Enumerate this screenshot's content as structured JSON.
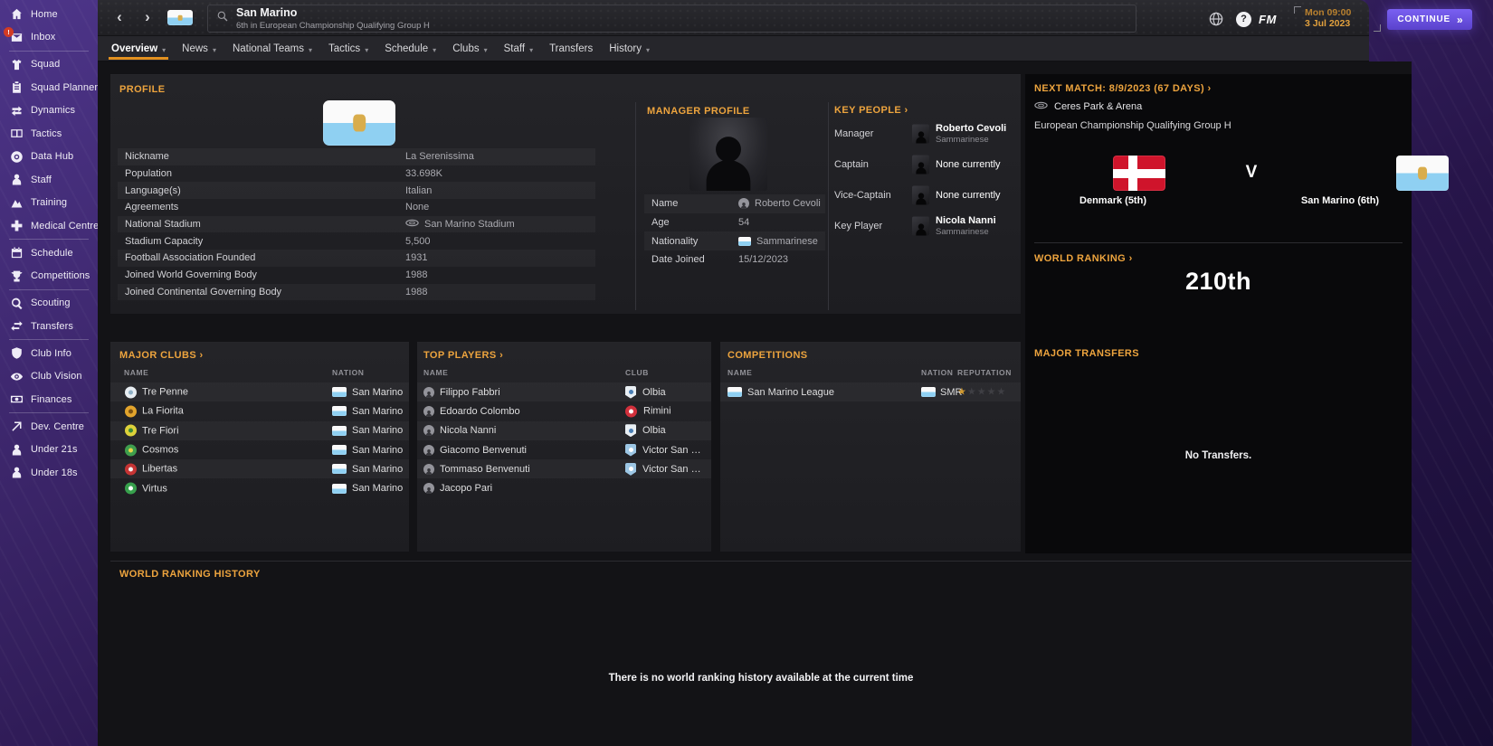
{
  "app": {
    "continue_label": "CONTINUE",
    "continue_arrows": "»",
    "back_glyph": "‹",
    "forward_glyph": "›",
    "help_glyph": "?",
    "fm_logo": "FM",
    "clock": {
      "time_line": "Mon 09:00",
      "date_line": "3 Jul 2023"
    }
  },
  "header": {
    "title": "San Marino",
    "subtitle": "6th in European Championship Qualifying Group H"
  },
  "tabs": [
    {
      "label": "Overview",
      "caret": true,
      "active": true
    },
    {
      "label": "News",
      "caret": true
    },
    {
      "label": "National Teams",
      "caret": true
    },
    {
      "label": "Tactics",
      "caret": true
    },
    {
      "label": "Schedule",
      "caret": true
    },
    {
      "label": "Clubs",
      "caret": true
    },
    {
      "label": "Staff",
      "caret": true
    },
    {
      "label": "Transfers",
      "caret": false
    },
    {
      "label": "History",
      "caret": true
    }
  ],
  "sidebar": [
    {
      "label": "Home",
      "icon": "home-icon"
    },
    {
      "label": "Inbox",
      "icon": "inbox-icon",
      "badge": "!",
      "divider_after": true
    },
    {
      "label": "Squad",
      "icon": "squad-icon"
    },
    {
      "label": "Squad Planner",
      "icon": "squad-planner-icon"
    },
    {
      "label": "Dynamics",
      "icon": "dynamics-icon"
    },
    {
      "label": "Tactics",
      "icon": "tactics-icon"
    },
    {
      "label": "Data Hub",
      "icon": "data-hub-icon"
    },
    {
      "label": "Staff",
      "icon": "staff-icon"
    },
    {
      "label": "Training",
      "icon": "training-icon"
    },
    {
      "label": "Medical Centre",
      "icon": "medical-centre-icon",
      "divider_after": true
    },
    {
      "label": "Schedule",
      "icon": "schedule-icon"
    },
    {
      "label": "Competitions",
      "icon": "competitions-icon",
      "divider_after": true
    },
    {
      "label": "Scouting",
      "icon": "scouting-icon"
    },
    {
      "label": "Transfers",
      "icon": "transfers-icon",
      "divider_after": true
    },
    {
      "label": "Club Info",
      "icon": "club-info-icon"
    },
    {
      "label": "Club Vision",
      "icon": "club-vision-icon"
    },
    {
      "label": "Finances",
      "icon": "finances-icon",
      "divider_after": true
    },
    {
      "label": "Dev. Centre",
      "icon": "dev-centre-icon"
    },
    {
      "label": "Under 21s",
      "icon": "under-21s-icon"
    },
    {
      "label": "Under 18s",
      "icon": "under-18s-icon"
    }
  ],
  "profile": {
    "title": "PROFILE",
    "rows": [
      {
        "label": "Nickname",
        "value": "La Serenissima"
      },
      {
        "label": "Population",
        "value": "33.698K"
      },
      {
        "label": "Language(s)",
        "value": "Italian"
      },
      {
        "label": "Agreements",
        "value": "None"
      },
      {
        "label": "National Stadium",
        "value": "San Marino Stadium",
        "icon": "stadium-icon"
      },
      {
        "label": "Stadium Capacity",
        "value": "5,500"
      },
      {
        "label": "Football Association Founded",
        "value": "1931"
      },
      {
        "label": "Joined World Governing Body",
        "value": "1988"
      },
      {
        "label": "Joined Continental Governing Body",
        "value": "1988"
      }
    ]
  },
  "manager": {
    "title": "MANAGER PROFILE",
    "rows": [
      {
        "label": "Name",
        "value": "Roberto Cevoli",
        "icon": "face-icon"
      },
      {
        "label": "Age",
        "value": "54"
      },
      {
        "label": "Nationality",
        "value": "Sammarinese",
        "icon": "flag-san-marino"
      },
      {
        "label": "Date Joined",
        "value": "15/12/2023"
      }
    ]
  },
  "key_people": {
    "title": "KEY PEOPLE ›",
    "rows": [
      {
        "role": "Manager",
        "name": "Roberto Cevoli",
        "nationality": "Sammarinese"
      },
      {
        "role": "Captain",
        "name": "None currently"
      },
      {
        "role": "Vice-Captain",
        "name": "None currently"
      },
      {
        "role": "Key Player",
        "name": "Nicola Nanni",
        "nationality": "Sammarinese"
      }
    ]
  },
  "next_match": {
    "title": "NEXT MATCH: 8/9/2023 (67 DAYS) ›",
    "venue": "Ceres Park & Arena",
    "competition": "European Championship Qualifying Group H",
    "home_team": "Denmark (5th)",
    "versus": "V",
    "away_team": "San Marino (6th)"
  },
  "world_ranking": {
    "title": "WORLD RANKING ›",
    "value": "210th"
  },
  "major_clubs": {
    "title": "MAJOR CLUBS ›",
    "columns": [
      "NAME",
      "NATION"
    ],
    "rows": [
      {
        "name": "Tre Penne",
        "nation": "San Marino",
        "badge": {
          "shape": "circle",
          "bg": "#e8edf2",
          "accent": "#8fb0c6"
        }
      },
      {
        "name": "La Fiorita",
        "nation": "San Marino",
        "badge": {
          "shape": "circle",
          "bg": "#e2a42c",
          "accent": "#7c5212"
        }
      },
      {
        "name": "Tre Fiori",
        "nation": "San Marino",
        "badge": {
          "shape": "circle",
          "bg": "#ddd23a",
          "accent": "#3a8a3a"
        }
      },
      {
        "name": "Cosmos",
        "nation": "San Marino",
        "badge": {
          "shape": "circle",
          "bg": "#3f9e4d",
          "accent": "#e6d44a"
        }
      },
      {
        "name": "Libertas",
        "nation": "San Marino",
        "badge": {
          "shape": "circle",
          "bg": "#c53434",
          "accent": "#f0f0f0"
        }
      },
      {
        "name": "Virtus",
        "nation": "San Marino",
        "badge": {
          "shape": "circle",
          "bg": "#37a04c",
          "accent": "#ffffff"
        }
      }
    ]
  },
  "top_players": {
    "title": "TOP PLAYERS ›",
    "columns": [
      "NAME",
      "CLUB"
    ],
    "rows": [
      {
        "name": "Filippo Fabbri",
        "club": "Olbia",
        "badge": {
          "shape": "shield",
          "bg": "#e9eff4",
          "accent": "#4a7fb5"
        }
      },
      {
        "name": "Edoardo Colombo",
        "club": "Rimini",
        "badge": {
          "shape": "circle",
          "bg": "#d2303c",
          "accent": "#ffffff"
        }
      },
      {
        "name": "Nicola Nanni",
        "club": "Olbia",
        "badge": {
          "shape": "shield",
          "bg": "#e9eff4",
          "accent": "#4a7fb5"
        }
      },
      {
        "name": "Giacomo Benvenuti",
        "club": "Victor San Mari...",
        "badge": {
          "shape": "shield",
          "bg": "#9cc6e4",
          "accent": "#ffffff"
        }
      },
      {
        "name": "Tommaso Benvenuti",
        "club": "Victor San Mari...",
        "badge": {
          "shape": "shield",
          "bg": "#9cc6e4",
          "accent": "#ffffff"
        }
      },
      {
        "name": "Jacopo Pari",
        "club": "",
        "badge": null
      }
    ]
  },
  "competitions": {
    "title": "COMPETITIONS",
    "columns": [
      "NAME",
      "NATION",
      "REPUTATION"
    ],
    "rows": [
      {
        "name": "San Marino League",
        "nation_code": "SMR",
        "stars": 1,
        "stars_max": 5
      }
    ]
  },
  "major_transfers": {
    "title": "MAJOR TRANSFERS",
    "empty": "No Transfers."
  },
  "ranking_history": {
    "title": "WORLD RANKING HISTORY",
    "empty": "There is no world ranking history available at the current time"
  },
  "icons": {
    "star": "★",
    "caret_down": "▾"
  },
  "colors": {
    "accent_orange": "#eda43e",
    "tab_underline": "#e2901f",
    "continue_purple": "#6a50e0",
    "star_gold": "#d29a2f",
    "san_marino_blue": "#8fd0f2",
    "denmark_red": "#cf142b"
  }
}
